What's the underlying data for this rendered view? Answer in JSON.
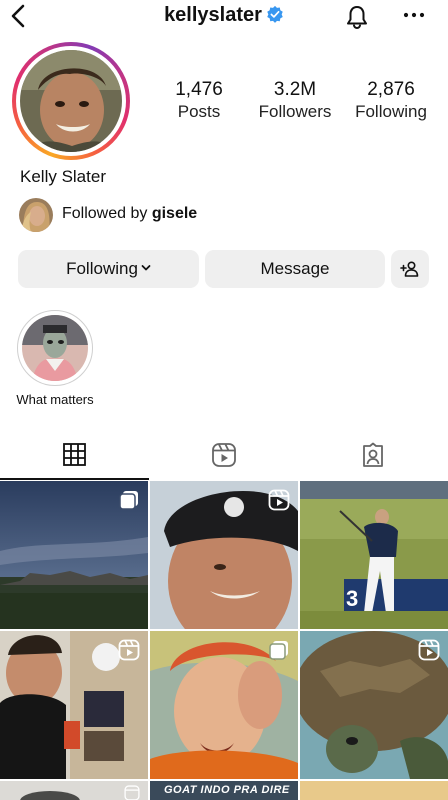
{
  "header": {
    "username": "kellyslater",
    "icons": [
      "back-chevron-icon",
      "verified-badge-icon",
      "bell-icon",
      "more-options-icon"
    ]
  },
  "profile": {
    "display_name": "Kelly Slater",
    "stats": [
      {
        "value": "1,476",
        "label": "Posts"
      },
      {
        "value": "3.2M",
        "label": "Followers"
      },
      {
        "value": "2,876",
        "label": "Following"
      }
    ],
    "followed_by_prefix": "Followed by ",
    "followed_by_user": "gisele"
  },
  "actions": {
    "following_label": "Following",
    "message_label": "Message",
    "add_icon": "add-person-icon"
  },
  "highlights": [
    {
      "label": "What matters"
    }
  ],
  "tabs": [
    {
      "icon": "grid-icon",
      "active": true
    },
    {
      "icon": "reels-icon",
      "active": false
    },
    {
      "icon": "tagged-icon",
      "active": false
    }
  ],
  "grid_posts": [
    {
      "type": "multi-photo",
      "overlay_text": ""
    },
    {
      "type": "reel",
      "overlay_text": ""
    },
    {
      "type": "photo",
      "overlay_text": ""
    },
    {
      "type": "reel",
      "overlay_text": ""
    },
    {
      "type": "multi-photo",
      "overlay_text": ""
    },
    {
      "type": "reel",
      "overlay_text": ""
    },
    {
      "type": "reel",
      "overlay_text": ""
    },
    {
      "type": "reel",
      "overlay_text": "GOAT INDO PRA DIRE"
    },
    {
      "type": "photo",
      "overlay_text": ""
    }
  ],
  "colors": {
    "text": "#111111",
    "button_bg": "#efefef",
    "verified_blue": "#3897f0",
    "story_ring": [
      "#f9a825",
      "#e1306c",
      "#833ab4"
    ]
  }
}
